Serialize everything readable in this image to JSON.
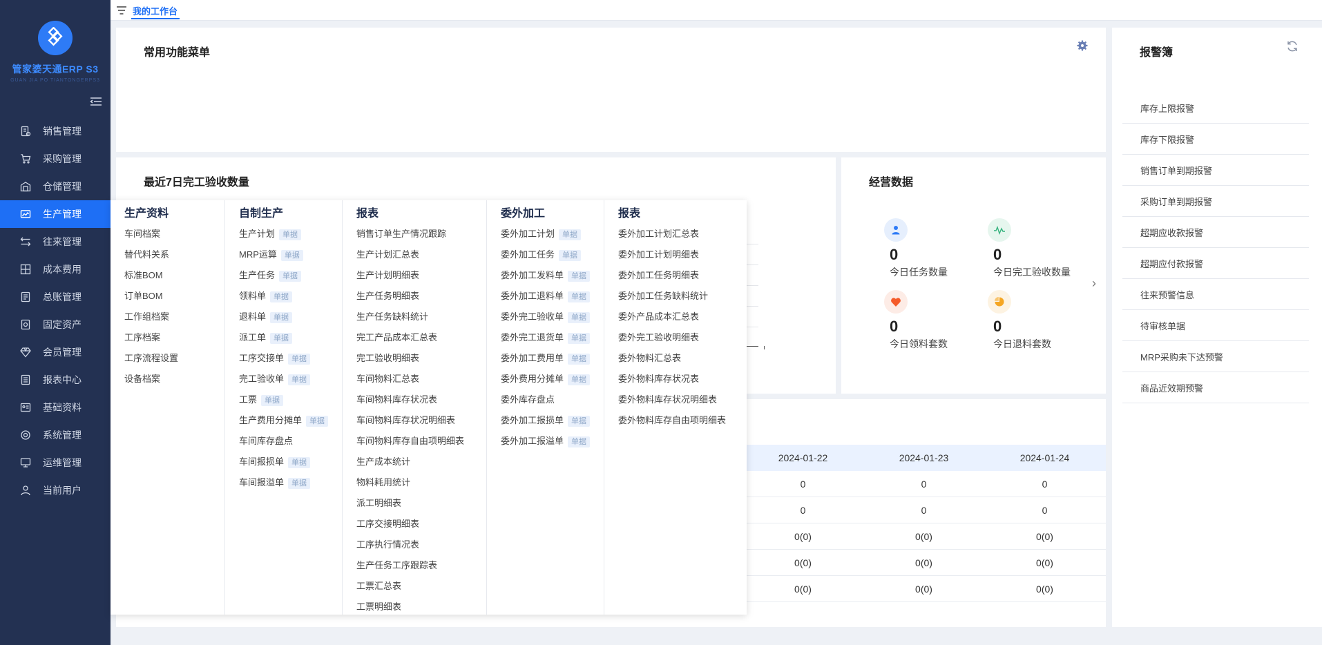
{
  "sidebar": {
    "brand": "管家婆天通ERP S3",
    "brand_sub": "GUAN JIA PO TIANTONGERPS3",
    "items": [
      {
        "label": "销售管理",
        "icon": "sales-doc-icon"
      },
      {
        "label": "采购管理",
        "icon": "cart-icon"
      },
      {
        "label": "仓储管理",
        "icon": "warehouse-icon"
      },
      {
        "label": "生产管理",
        "icon": "factory-icon",
        "active": true
      },
      {
        "label": "往来管理",
        "icon": "exchange-icon"
      },
      {
        "label": "成本费用",
        "icon": "cost-icon"
      },
      {
        "label": "总账管理",
        "icon": "ledger-icon"
      },
      {
        "label": "固定资产",
        "icon": "asset-icon"
      },
      {
        "label": "会员管理",
        "icon": "diamond-icon"
      },
      {
        "label": "报表中心",
        "icon": "report-icon"
      },
      {
        "label": "基础资料",
        "icon": "id-card-icon"
      },
      {
        "label": "系统管理",
        "icon": "gear-icon"
      },
      {
        "label": "运维管理",
        "icon": "monitor-icon"
      },
      {
        "label": "当前用户",
        "icon": "user-icon"
      }
    ]
  },
  "topbar": {
    "tab": "我的工作台"
  },
  "common_menu": {
    "title": "常用功能菜单"
  },
  "recent": {
    "title": "最近7日完工验收数量"
  },
  "business": {
    "title": "经营数据",
    "stats": [
      {
        "value": "0",
        "label": "今日任务数量",
        "icon": "user-icon",
        "color": "#2e7bf6",
        "bg": "#e6effd"
      },
      {
        "value": "0",
        "label": "今日完工验收数量",
        "icon": "pulse-icon",
        "color": "#36b37e",
        "bg": "#e6f6ee"
      },
      {
        "value": "0",
        "label": "今日领料套数",
        "icon": "heart-icon",
        "color": "#f45b2a",
        "bg": "#fdece6"
      },
      {
        "value": "0",
        "label": "今日退料套数",
        "icon": "pie-icon",
        "color": "#f5a623",
        "bg": "#fdf3e2"
      }
    ]
  },
  "alerts": {
    "title": "报警簿",
    "items": [
      "库存上限报警",
      "库存下限报警",
      "销售订单到期报警",
      "采购订单到期报警",
      "超期应收款报警",
      "超期应付款报警",
      "往来预警信息",
      "待审核单据",
      "MRP采购未下达预警",
      "商品近效期预警"
    ]
  },
  "table": {
    "headers": [
      "2024-01-22",
      "2024-01-23",
      "2024-01-24"
    ],
    "rows": [
      [
        "0",
        "0",
        "0"
      ],
      [
        "0",
        "0",
        "0"
      ],
      [
        "0(0)",
        "0(0)",
        "0(0)"
      ],
      [
        "0(0)",
        "0(0)",
        "0(0)"
      ],
      [
        "0(0)",
        "0(0)",
        "0(0)"
      ]
    ]
  },
  "mega_menu": {
    "badge": "单据",
    "columns": [
      {
        "title": "生产资料",
        "items": [
          {
            "label": "车间档案"
          },
          {
            "label": "替代料关系"
          },
          {
            "label": "标准BOM"
          },
          {
            "label": "订单BOM"
          },
          {
            "label": "工作组档案"
          },
          {
            "label": "工序档案"
          },
          {
            "label": "工序流程设置"
          },
          {
            "label": "设备档案"
          }
        ]
      },
      {
        "title": "自制生产",
        "items": [
          {
            "label": "生产计划",
            "badge": true
          },
          {
            "label": "MRP运算",
            "badge": true
          },
          {
            "label": "生产任务",
            "badge": true
          },
          {
            "label": "领料单",
            "badge": true
          },
          {
            "label": "退料单",
            "badge": true
          },
          {
            "label": "派工单",
            "badge": true
          },
          {
            "label": "工序交接单",
            "badge": true
          },
          {
            "label": "完工验收单",
            "badge": true
          },
          {
            "label": "工票",
            "badge": true
          },
          {
            "label": "生产费用分摊单",
            "badge": true
          },
          {
            "label": "车间库存盘点"
          },
          {
            "label": "车间报损单",
            "badge": true
          },
          {
            "label": "车间报溢单",
            "badge": true
          }
        ]
      },
      {
        "title": "报表",
        "items": [
          {
            "label": "销售订单生产情况跟踪"
          },
          {
            "label": "生产计划汇总表"
          },
          {
            "label": "生产计划明细表"
          },
          {
            "label": "生产任务明细表"
          },
          {
            "label": "生产任务缺料统计"
          },
          {
            "label": "完工产品成本汇总表"
          },
          {
            "label": "完工验收明细表"
          },
          {
            "label": "车间物料汇总表"
          },
          {
            "label": "车间物料库存状况表"
          },
          {
            "label": "车间物料库存状况明细表"
          },
          {
            "label": "车间物料库存自由项明细表"
          },
          {
            "label": "生产成本统计"
          },
          {
            "label": "物料耗用统计"
          },
          {
            "label": "派工明细表"
          },
          {
            "label": "工序交接明细表"
          },
          {
            "label": "工序执行情况表"
          },
          {
            "label": "生产任务工序跟踪表"
          },
          {
            "label": "工票汇总表"
          },
          {
            "label": "工票明细表"
          }
        ]
      },
      {
        "title": "委外加工",
        "items": [
          {
            "label": "委外加工计划",
            "badge": true
          },
          {
            "label": "委外加工任务",
            "badge": true
          },
          {
            "label": "委外加工发料单",
            "badge": true
          },
          {
            "label": "委外加工退料单",
            "badge": true
          },
          {
            "label": "委外完工验收单",
            "badge": true
          },
          {
            "label": "委外完工退货单",
            "badge": true
          },
          {
            "label": "委外加工费用单",
            "badge": true
          },
          {
            "label": "委外费用分摊单",
            "badge": true
          },
          {
            "label": "委外库存盘点"
          },
          {
            "label": "委外加工报损单",
            "badge": true
          },
          {
            "label": "委外加工报溢单",
            "badge": true
          }
        ]
      },
      {
        "title": "报表",
        "items": [
          {
            "label": "委外加工计划汇总表"
          },
          {
            "label": "委外加工计划明细表"
          },
          {
            "label": "委外加工任务明细表"
          },
          {
            "label": "委外加工任务缺料统计"
          },
          {
            "label": "委外产品成本汇总表"
          },
          {
            "label": "委外完工验收明细表"
          },
          {
            "label": "委外物料汇总表"
          },
          {
            "label": "委外物料库存状况表"
          },
          {
            "label": "委外物料库存状况明细表"
          },
          {
            "label": "委外物料库存自由项明细表"
          }
        ]
      }
    ]
  }
}
